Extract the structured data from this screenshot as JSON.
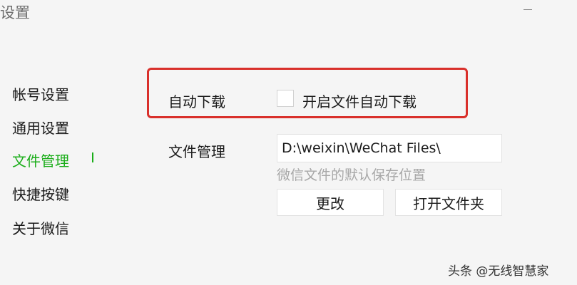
{
  "window": {
    "title": "设置",
    "minimize_icon": "minimize-icon"
  },
  "sidebar": {
    "items": [
      {
        "label": "帐号设置",
        "active": false
      },
      {
        "label": "通用设置",
        "active": false
      },
      {
        "label": "文件管理",
        "active": true
      },
      {
        "label": "快捷按键",
        "active": false
      },
      {
        "label": "关于微信",
        "active": false
      }
    ],
    "active_color": "#1aad19"
  },
  "main": {
    "auto_download": {
      "label": "自动下载",
      "checkbox_label": "开启文件自动下载",
      "checked": false
    },
    "file_management": {
      "label": "文件管理",
      "path_value": "D:\\weixin\\WeChat Files\\",
      "hint": "微信文件的默认保存位置",
      "change_button": "更改",
      "open_folder_button": "打开文件夹"
    }
  },
  "highlight_color": "#d9302b",
  "watermark": "头条 @无线智慧家"
}
